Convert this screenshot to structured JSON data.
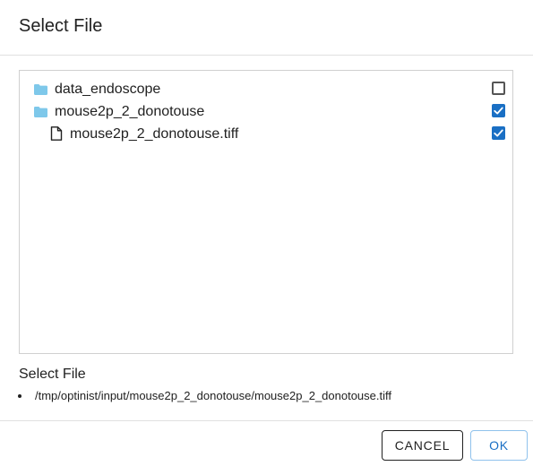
{
  "dialog": {
    "title": "Select File"
  },
  "tree": {
    "items": [
      {
        "type": "folder",
        "label": "data_endoscope",
        "checked": false,
        "icon": "folder-icon"
      },
      {
        "type": "folder",
        "label": "mouse2p_2_donotouse",
        "checked": true,
        "icon": "folder-icon"
      },
      {
        "type": "file",
        "label": "mouse2p_2_donotouse.tiff",
        "checked": true,
        "icon": "file-icon"
      }
    ]
  },
  "selection": {
    "label": "Select File",
    "paths": [
      "/tmp/optinist/input/mouse2p_2_donotouse/mouse2p_2_donotouse.tiff"
    ]
  },
  "actions": {
    "cancel_label": "CANCEL",
    "ok_label": "OK"
  },
  "colors": {
    "accent": "#1a6fc4",
    "folder": "#7ec8ea"
  }
}
